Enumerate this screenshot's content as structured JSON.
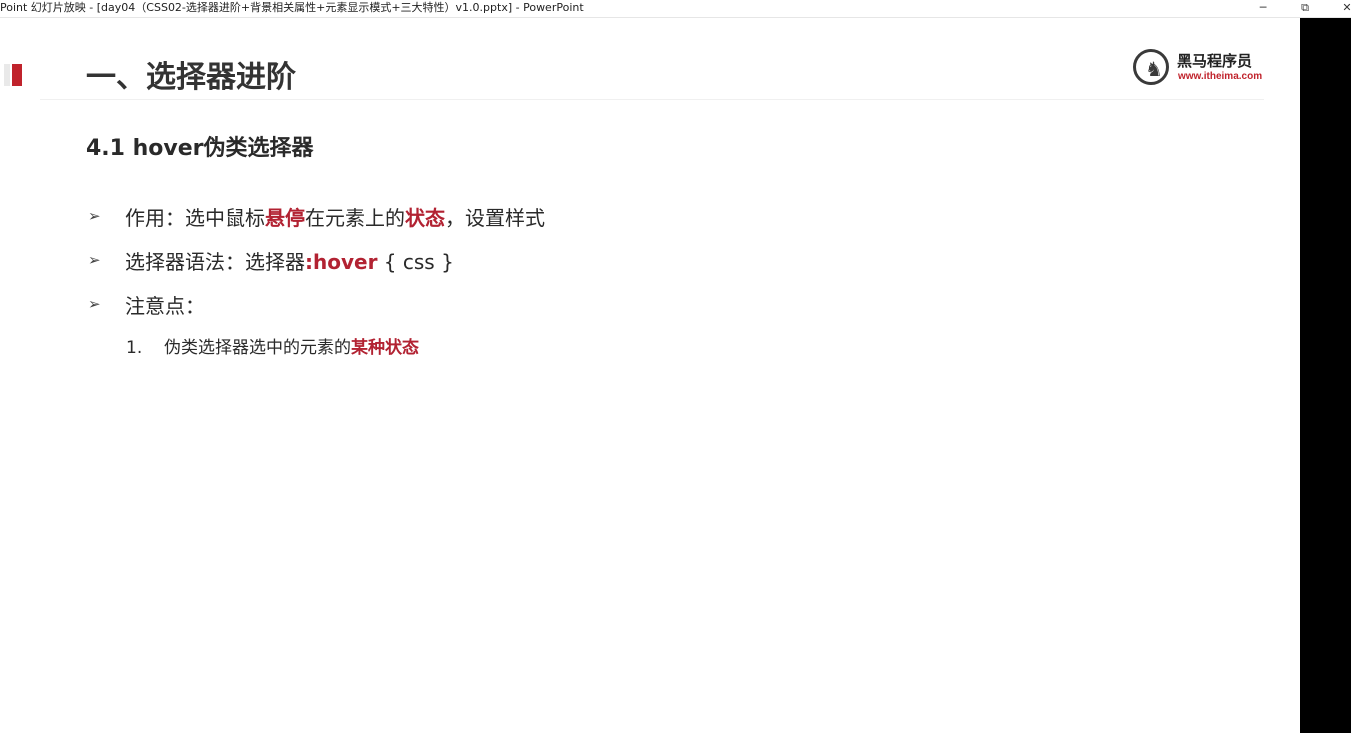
{
  "window": {
    "title": "Point 幻灯片放映 - [day04（CSS02-选择器进阶+背景相关属性+元素显示模式+三大特性）v1.0.pptx] - PowerPoint",
    "minimize_glyph": "─",
    "maximize_glyph": "⧉",
    "close_glyph": "✕"
  },
  "slide": {
    "title": "一、选择器进阶",
    "logo": {
      "name": "黑马程序员",
      "url": "www.itheima.com",
      "icon": "horse-logo-icon"
    },
    "subtitle": "4.1 hover伪类选择器",
    "bullets": [
      {
        "arrow": "➢",
        "part1": "作用：选中鼠标",
        "highlight1": "悬停",
        "part2": "在元素上的",
        "highlight2": "状态",
        "part3": "，设置样式"
      },
      {
        "arrow": "➢",
        "part1": "选择器语法：选择器",
        "highlight1": ":hover",
        "part2": " { css }"
      },
      {
        "arrow": "➢",
        "part1": "注意点："
      }
    ],
    "sub_items": [
      {
        "num": "1.",
        "text": "伪类选择器选中的元素的",
        "highlight": "某种状态"
      }
    ]
  },
  "colors": {
    "accent": "#b22232",
    "text": "#2a2a2a",
    "letterbox": "#000000"
  }
}
